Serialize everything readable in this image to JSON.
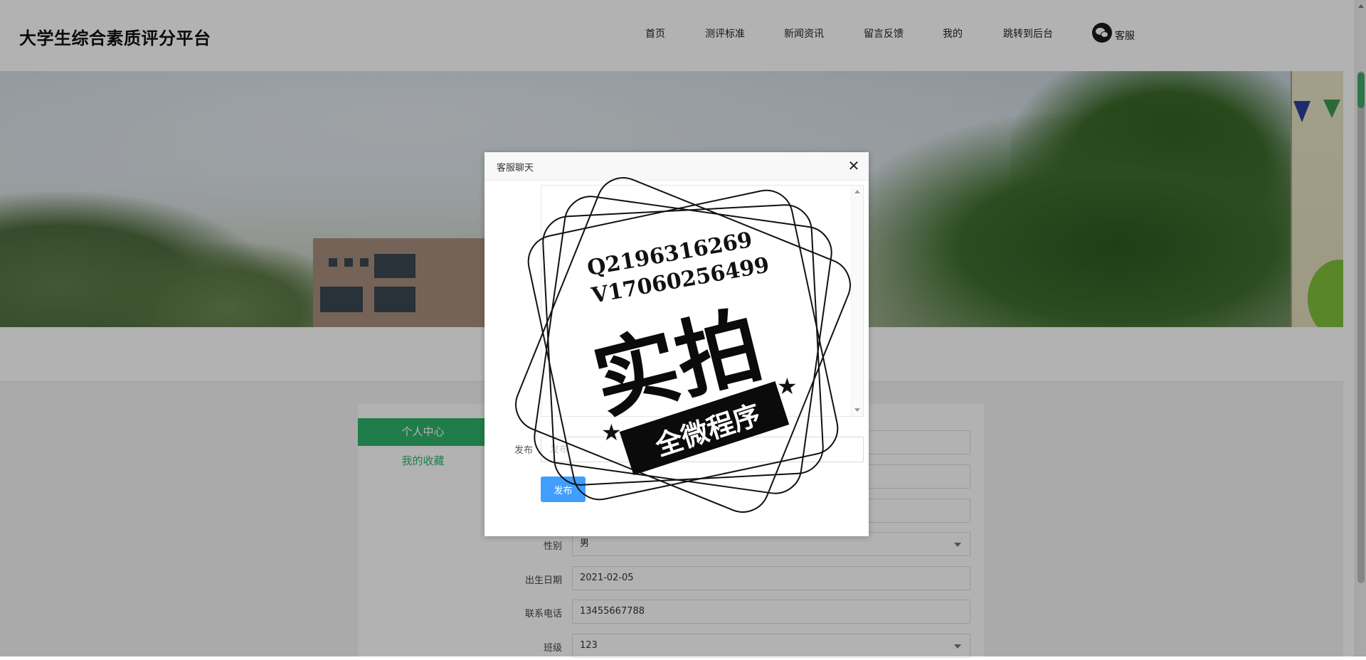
{
  "site": {
    "title": "大学生综合素质评分平台"
  },
  "nav": {
    "items": [
      {
        "label": "首页"
      },
      {
        "label": "测评标准"
      },
      {
        "label": "新闻资讯"
      },
      {
        "label": "留言反馈"
      },
      {
        "label": "我的"
      },
      {
        "label": "跳转到后台"
      }
    ],
    "customer_service": {
      "label": "客服",
      "icon": "wechat-icon"
    }
  },
  "sidebar": {
    "items": [
      {
        "label": "个人中心",
        "active": true
      },
      {
        "label": "我的收藏",
        "active": false
      }
    ]
  },
  "form": {
    "fields": [
      {
        "label": "性别",
        "value": "男",
        "type": "select"
      },
      {
        "label": "出生日期",
        "value": "2021-02-05",
        "type": "input"
      },
      {
        "label": "联系电话",
        "value": "13455667788",
        "type": "input"
      },
      {
        "label": "班级",
        "value": "123",
        "type": "select"
      }
    ]
  },
  "modal": {
    "title": "客服聊天",
    "close_icon": "close-icon",
    "post_label": "发布",
    "post_placeholder": "发布",
    "post_button": "发布"
  },
  "watermark": {
    "line1": "Q2196316269",
    "line2": "V17060256499",
    "big": "实拍",
    "ribbon": "全微程序"
  },
  "colors": {
    "accent": "#2fb36a",
    "button": "#409eff",
    "overlay": "rgba(0,0,0,0.3)"
  }
}
